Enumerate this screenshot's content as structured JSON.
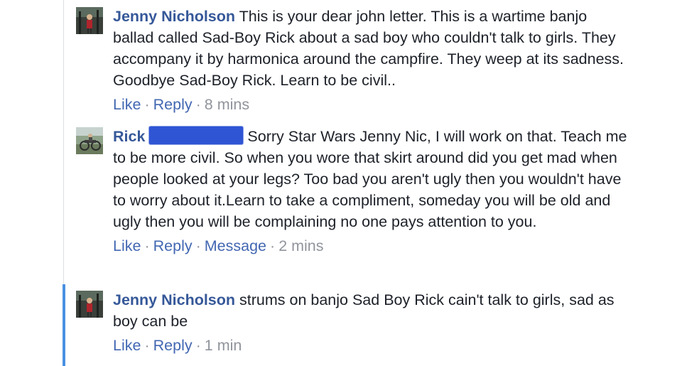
{
  "comments": [
    {
      "author": "Jenny Nicholson",
      "text": "This is your dear john letter. This is a wartime banjo ballad called Sad-Boy Rick about a sad boy who couldn't talk to girls. They accompany it by harmonica around the campfire. They weep at its sadness. Goodbye Sad-Boy Rick. Learn to be civil..",
      "actions": {
        "like": "Like",
        "reply": "Reply"
      },
      "sep": "·",
      "time": "8 mins"
    },
    {
      "author": "Rick",
      "text": "Sorry Star Wars Jenny Nic, I will work on that. Teach me to be more civil. So when you wore that skirt around did you get mad when people looked at your legs? Too bad you aren't ugly then you wouldn't have to worry about it.Learn to take a compliment, someday you will be old and ugly then you will be complaining no one pays attention to you.",
      "actions": {
        "like": "Like",
        "reply": "Reply",
        "message": "Message"
      },
      "sep": "·",
      "time": "2 mins"
    },
    {
      "author": "Jenny Nicholson",
      "text": "strums on banjo Sad Boy Rick cain't talk to girls, sad as boy can be",
      "actions": {
        "like": "Like",
        "reply": "Reply"
      },
      "sep": "·",
      "time": "1 min"
    }
  ],
  "colors": {
    "author_link": "#365899",
    "action_link": "#4267b2",
    "meta": "#90949c",
    "text": "#1d2129",
    "active_thread_bar": "#4a90e2",
    "redaction": "#2f55d4"
  }
}
